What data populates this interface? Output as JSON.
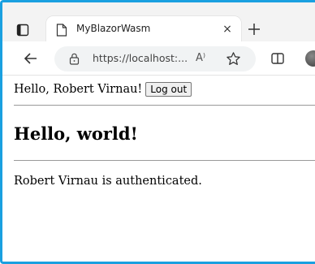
{
  "browser": {
    "tab_title": "MyBlazorWasm",
    "tab_close_glyph": "×",
    "url_display": "https://localhost:...",
    "read_aloud_glyph": "A⁾",
    "icons": {
      "tab_actions": "tab-actions-icon",
      "page": "page-icon",
      "new_tab": "plus-icon",
      "back": "back-arrow-icon",
      "lock": "lock-icon",
      "favorite": "star-icon",
      "split_screen": "split-screen-icon"
    }
  },
  "page": {
    "greeting": "Hello, Robert Virnau!",
    "logout_label": "Log out",
    "heading": "Hello, world!",
    "auth_status": "Robert Virnau is authenticated."
  },
  "colors": {
    "frame_accent": "#1aa0e0",
    "tabstrip_bg": "#f3f3f3",
    "address_bg": "#f1f3f4"
  }
}
